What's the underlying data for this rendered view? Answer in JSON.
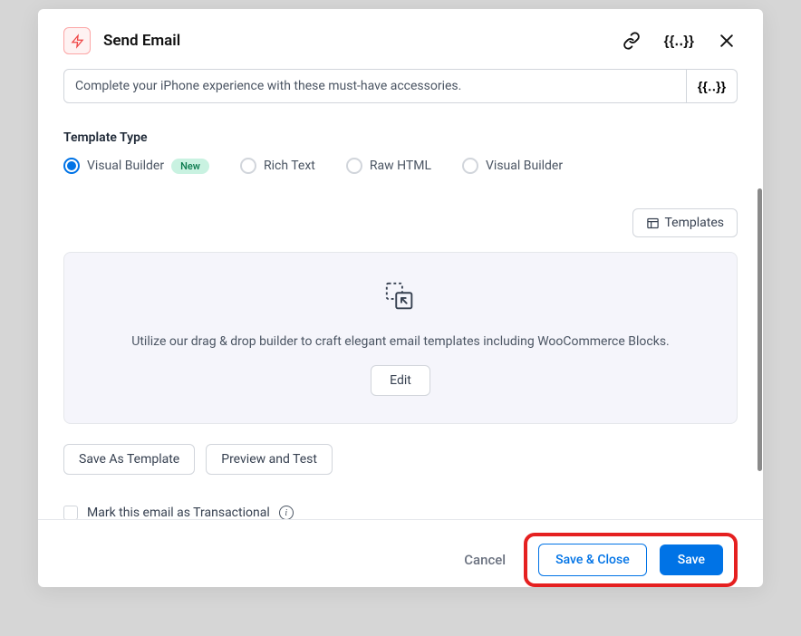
{
  "header": {
    "title": "Send Email"
  },
  "subject": {
    "value": "Complete your iPhone experience with these must-have accessories."
  },
  "template_type": {
    "label": "Template Type",
    "options": [
      {
        "label": "Visual Builder",
        "badge": "New"
      },
      {
        "label": "Rich Text"
      },
      {
        "label": "Raw HTML"
      },
      {
        "label": "Visual Builder"
      }
    ]
  },
  "templates_button": "Templates",
  "editor": {
    "description": "Utilize our drag & drop builder to craft elegant email templates including WooCommerce Blocks.",
    "edit_button": "Edit"
  },
  "actions": {
    "save_as_template": "Save As Template",
    "preview_test": "Preview and Test"
  },
  "transactional": {
    "label": "Mark this email as Transactional"
  },
  "footer": {
    "cancel": "Cancel",
    "save_close": "Save & Close",
    "save": "Save"
  }
}
